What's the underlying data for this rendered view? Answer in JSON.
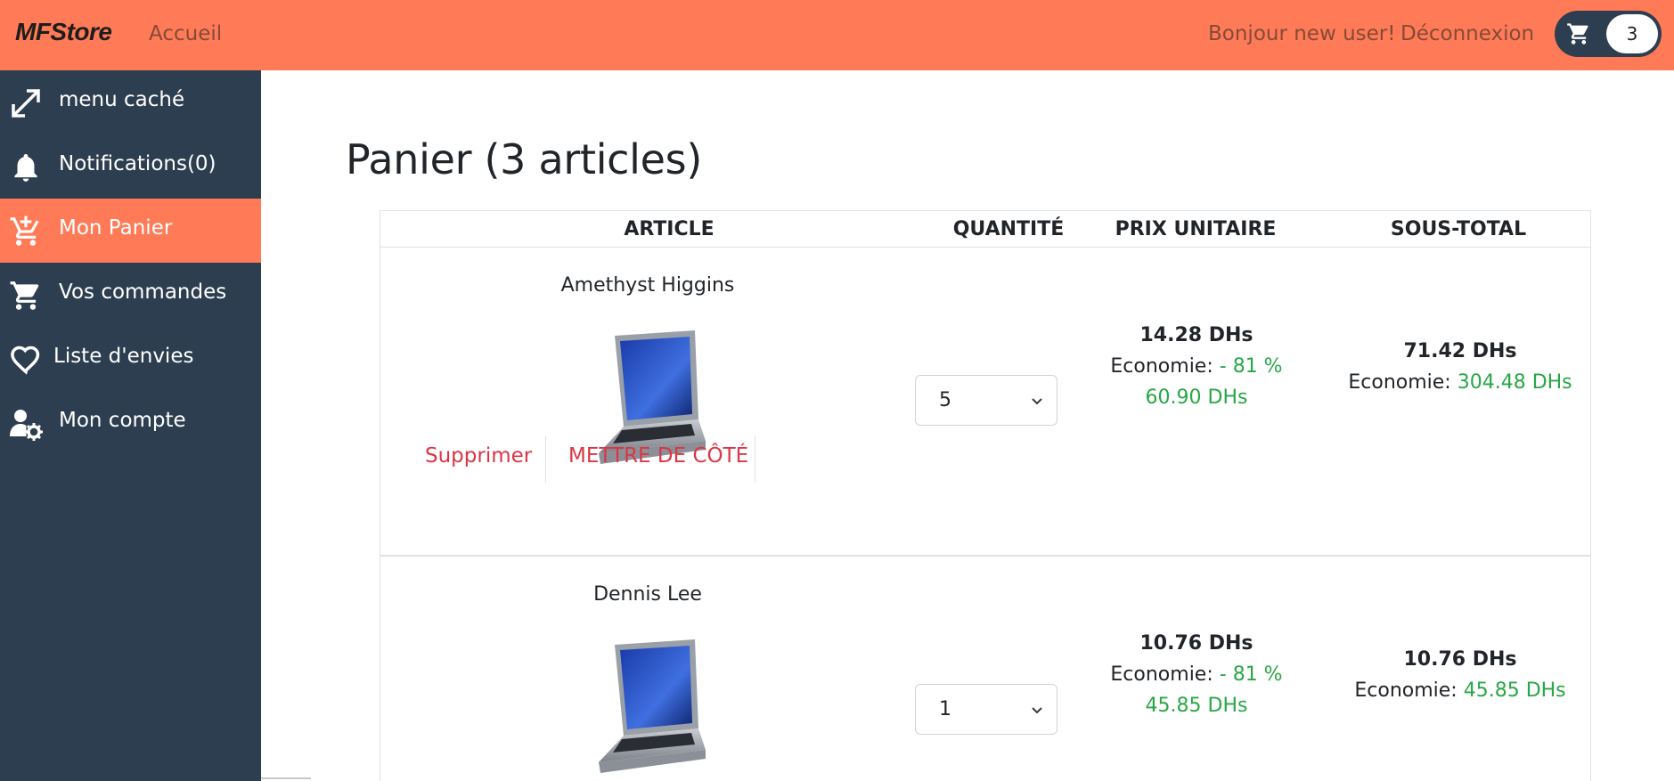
{
  "navbar": {
    "brand": "MFStore",
    "home": "Accueil",
    "greeting": "Bonjour new user!",
    "logout": "Déconnexion",
    "cart_count": "3"
  },
  "sidebar": {
    "items": [
      {
        "label": "menu caché",
        "icon": "expand-arrows-icon"
      },
      {
        "label": "Notifications(0)",
        "icon": "bell-icon"
      },
      {
        "label": "Mon Panier",
        "icon": "cart-plus-icon",
        "active": true
      },
      {
        "label": "Vos commandes",
        "icon": "cart-icon"
      },
      {
        "label": "Liste d'envies",
        "icon": "heart-icon"
      },
      {
        "label": "Mon compte",
        "icon": "user-gear-icon"
      }
    ]
  },
  "main": {
    "title": "Panier (3 articles)",
    "columns": [
      "ARTICLE",
      "QUANTITÉ",
      "PRIX UNITAIRE",
      "SOUS-TOTAL"
    ],
    "delete_label": "Supprimer",
    "save_later_label": "METTRE DE CÔTÉ",
    "savings_label": "Economie:",
    "rows": [
      {
        "name": "Amethyst Higgins",
        "quantity": "5",
        "unit_price": "14.28 DHs",
        "unit_discount": "- 81 %",
        "unit_saving": "60.90 DHs",
        "subtotal": "71.42 DHs",
        "subtotal_saving": "304.48 DHs"
      },
      {
        "name": "Dennis Lee",
        "quantity": "1",
        "unit_price": "10.76 DHs",
        "unit_discount": "- 81 %",
        "unit_saving": "45.85 DHs",
        "subtotal": "10.76 DHs",
        "subtotal_saving": "45.85 DHs"
      }
    ]
  },
  "colors": {
    "accent": "#ff7a56",
    "sidebar": "#2d3e50",
    "danger": "#dc3545",
    "success": "#28a745"
  }
}
